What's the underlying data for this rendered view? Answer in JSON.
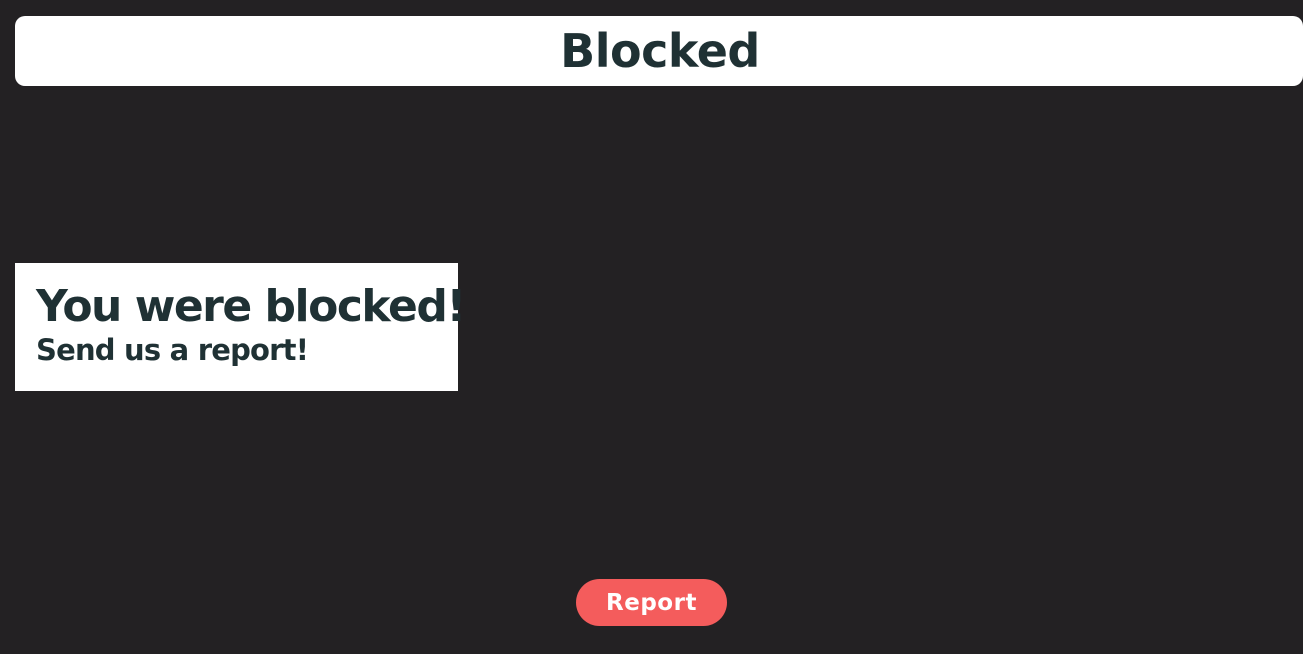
{
  "header": {
    "title": "Blocked"
  },
  "message": {
    "heading": "You were blocked!",
    "subheading": "Send us a report!"
  },
  "actions": {
    "report_label": "Report"
  },
  "colors": {
    "background": "#232123",
    "card": "#ffffff",
    "text": "#1f3134",
    "accent": "#f45c5c"
  }
}
